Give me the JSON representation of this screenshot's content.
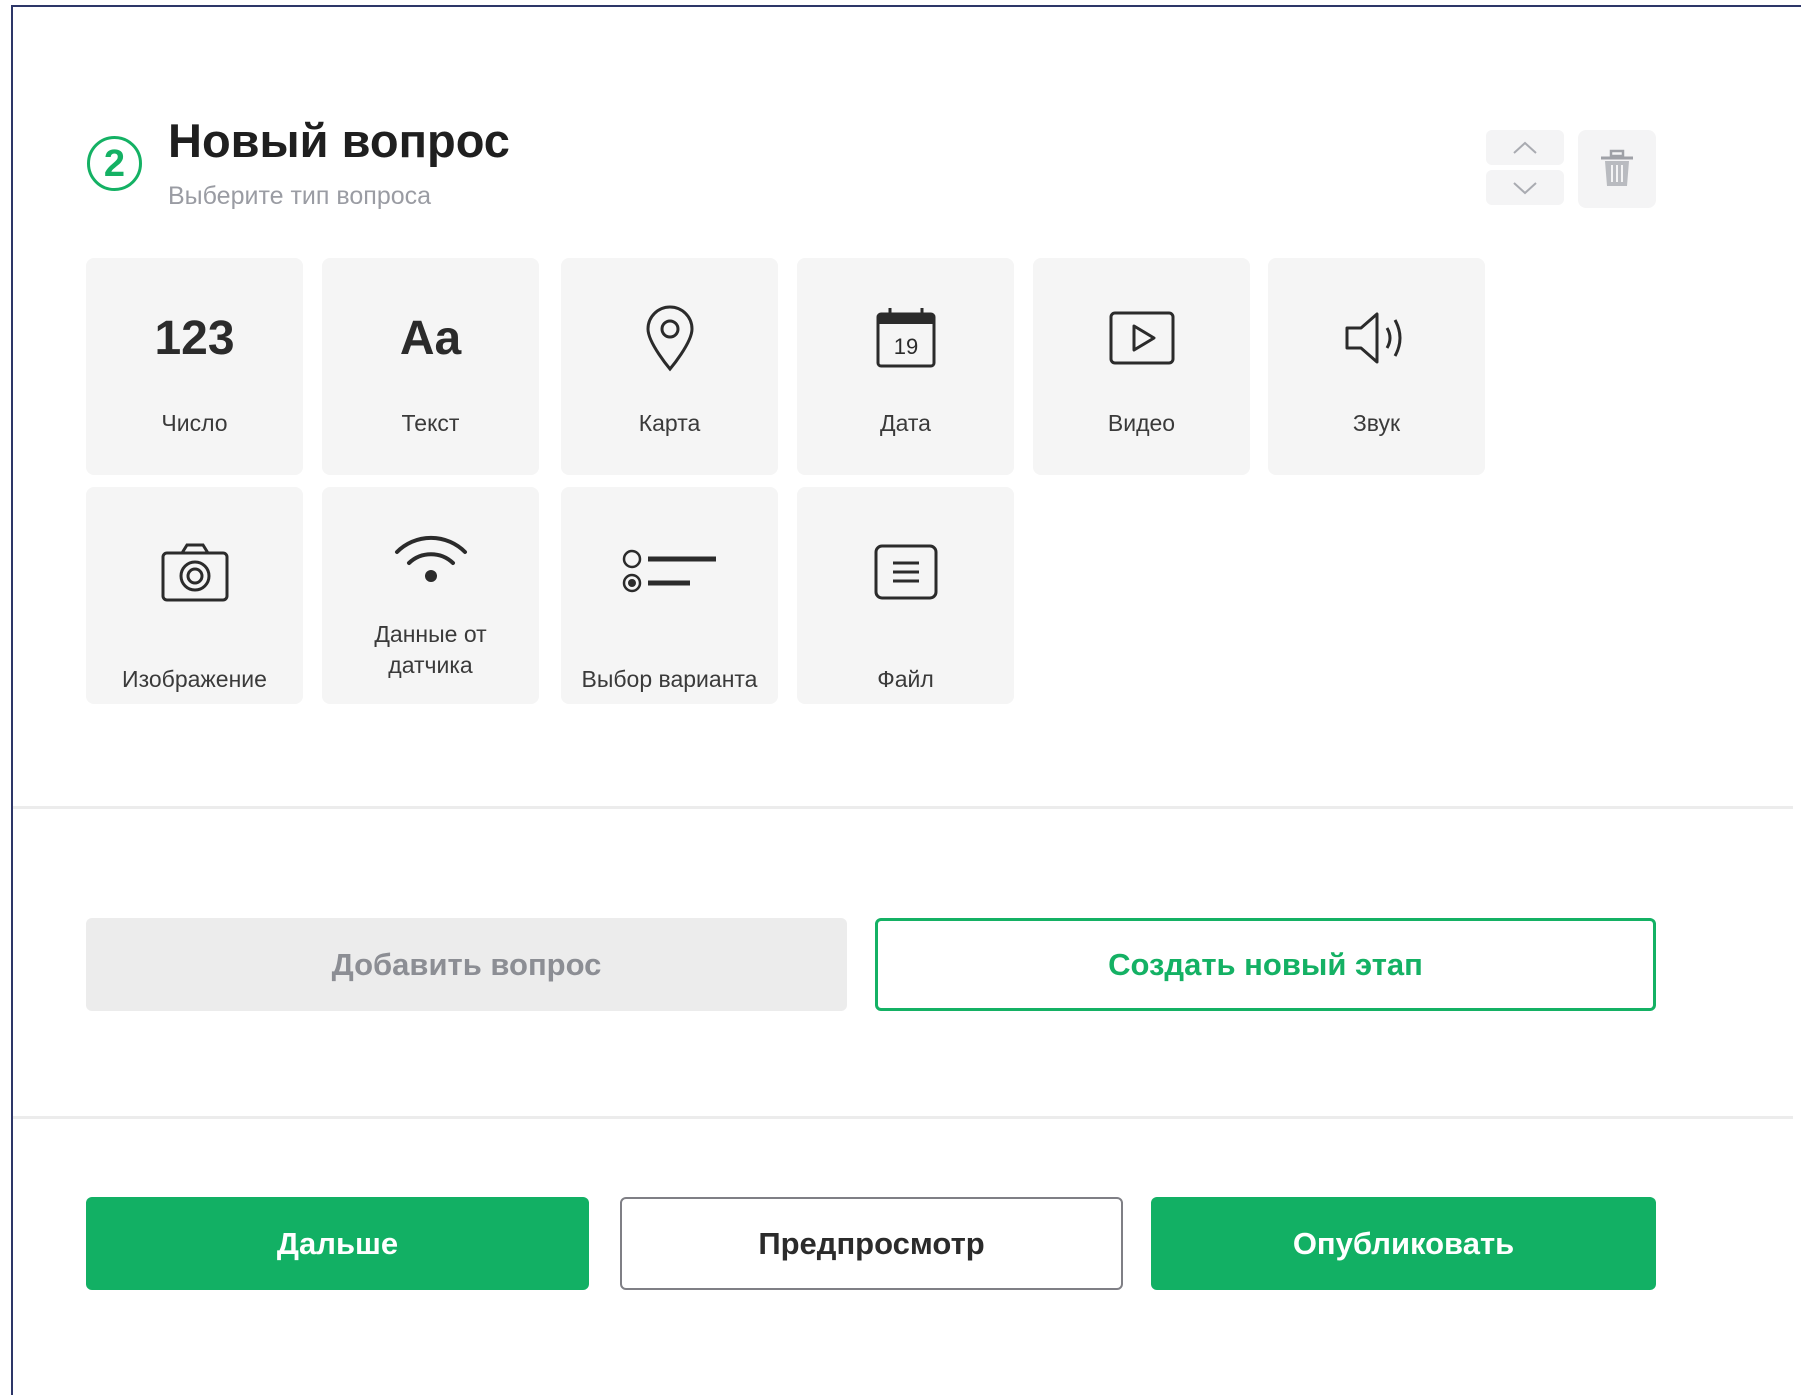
{
  "question": {
    "step_number": "2",
    "title": "Новый вопрос",
    "subtitle": "Выберите тип вопроса"
  },
  "question_types": [
    {
      "label": "Число",
      "icon": "number-123-icon",
      "icon_text": "123"
    },
    {
      "label": "Текст",
      "icon": "text-aa-icon",
      "icon_text": "Aa"
    },
    {
      "label": "Карта",
      "icon": "map-pin-icon"
    },
    {
      "label": "Дата",
      "icon": "calendar-icon",
      "icon_text": "19"
    },
    {
      "label": "Видео",
      "icon": "video-play-icon"
    },
    {
      "label": "Звук",
      "icon": "speaker-icon"
    },
    {
      "label": "Изображение",
      "icon": "camera-icon"
    },
    {
      "label_line1": "Данные от",
      "label_line2": "датчика",
      "icon": "wifi-sensor-icon"
    },
    {
      "label": "Выбор варианта",
      "icon": "radio-choice-icon"
    },
    {
      "label": "Файл",
      "icon": "file-document-icon"
    }
  ],
  "actions": {
    "add_question": "Добавить вопрос",
    "create_stage": "Создать новый этап",
    "next": "Дальше",
    "preview": "Предпросмотр",
    "publish": "Опубликовать"
  },
  "colors": {
    "accent": "#14b164",
    "tile_bg": "#f5f5f5",
    "disabled_bg": "#ececec",
    "frame_border": "#2d3668"
  }
}
